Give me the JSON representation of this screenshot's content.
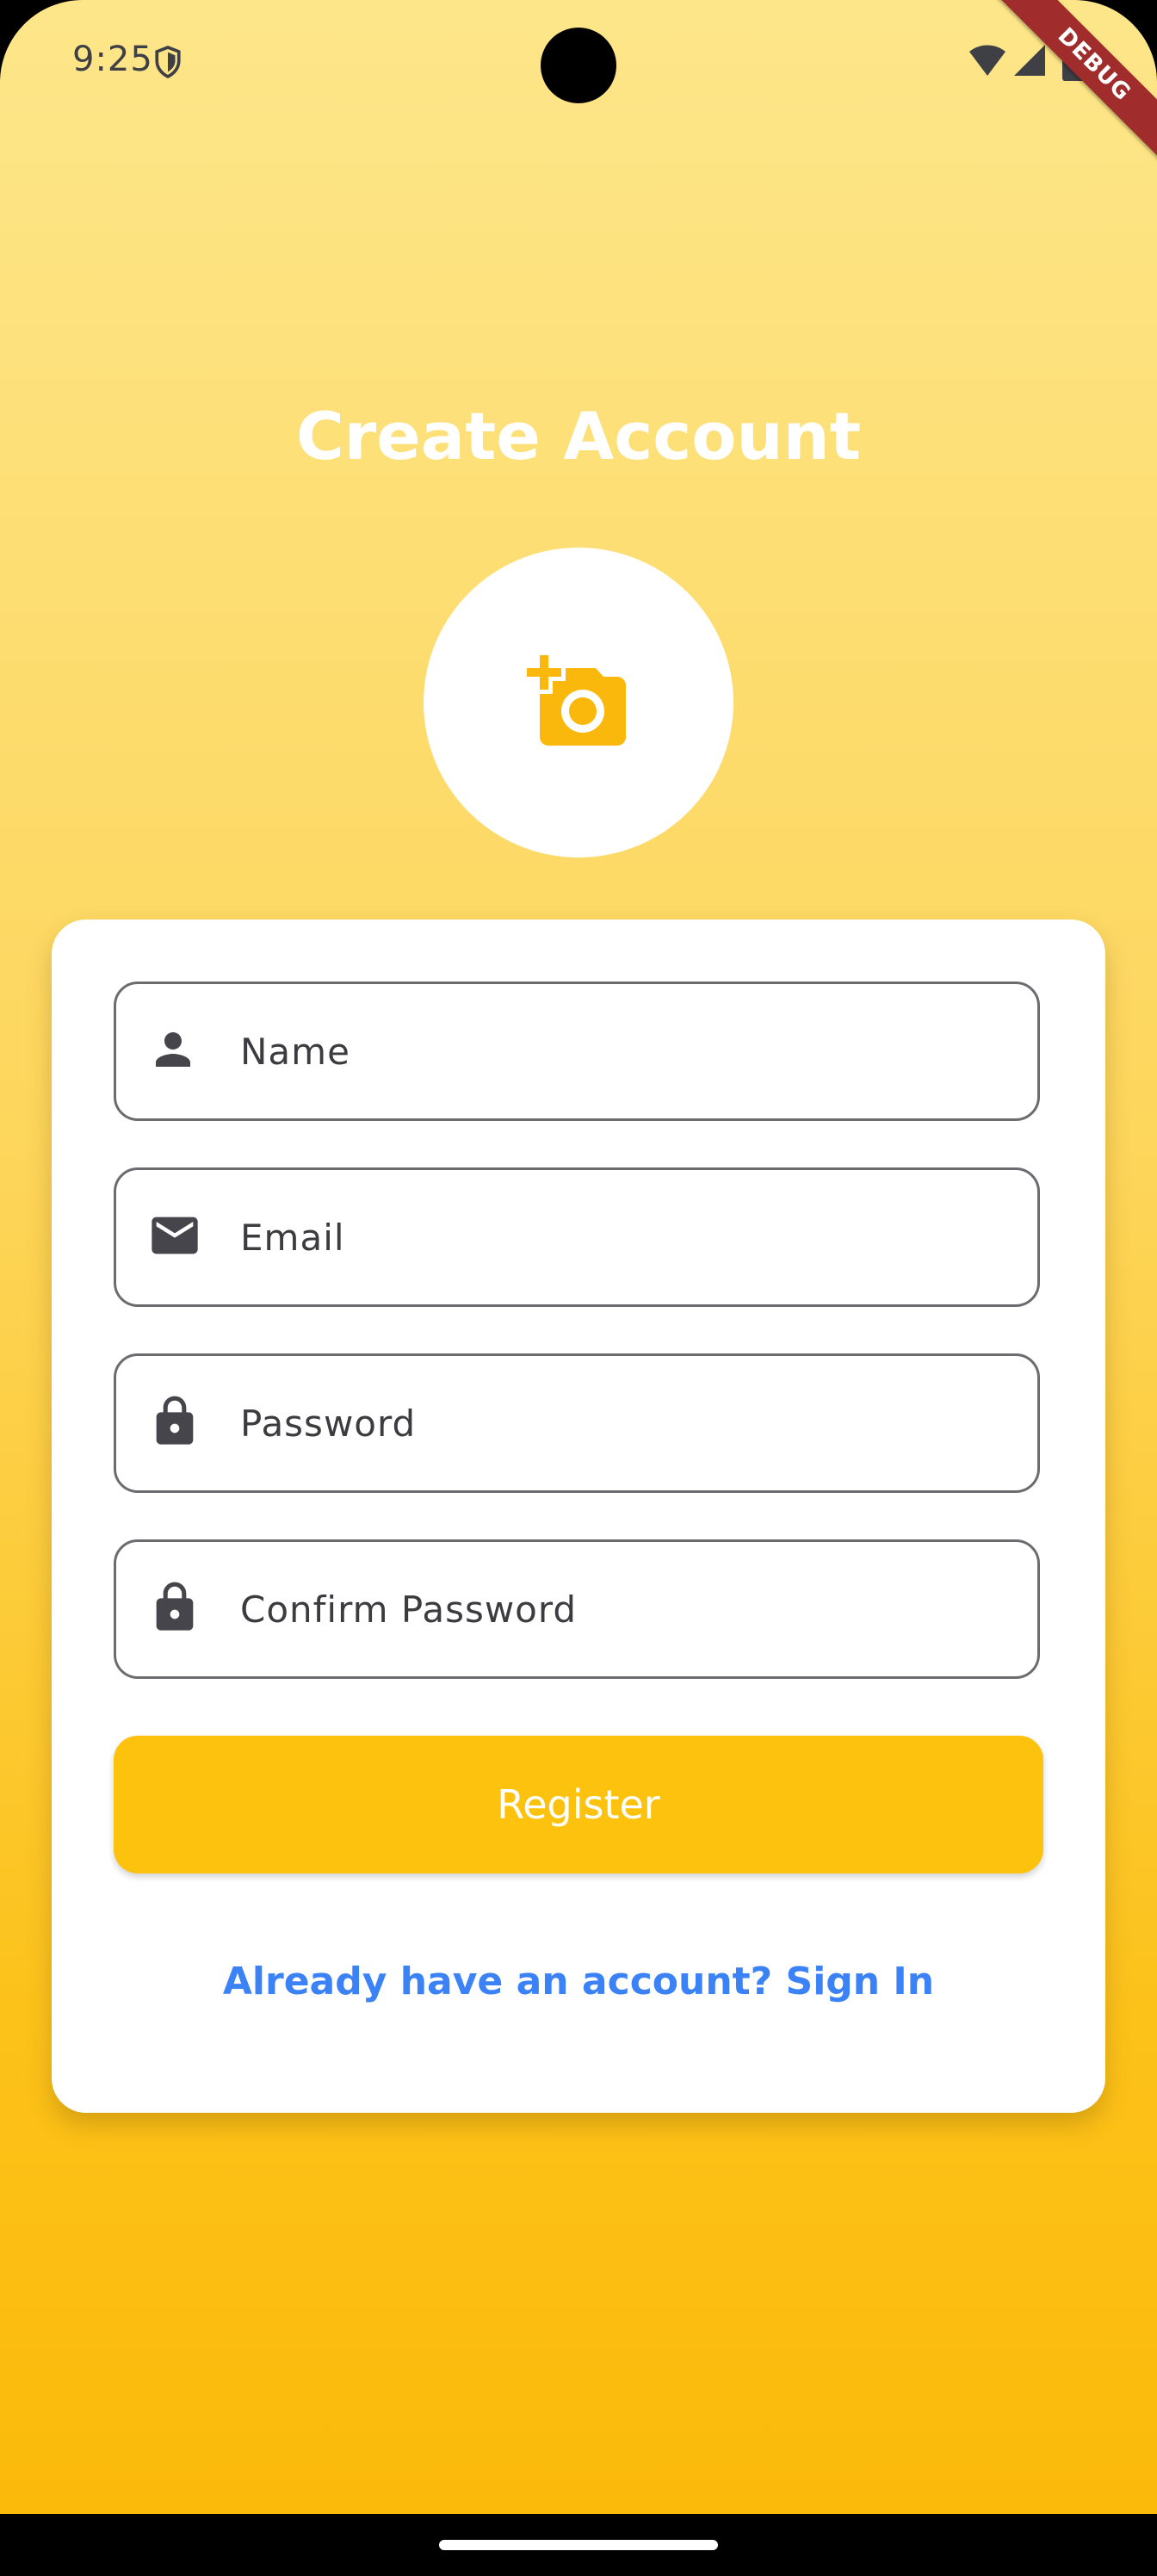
{
  "status_bar": {
    "time": "9:25",
    "icons": [
      "shield-icon",
      "wifi-icon",
      "signal-icon",
      "battery-icon"
    ]
  },
  "debug_banner": "DEBUG",
  "page": {
    "title": "Create Account"
  },
  "avatar": {
    "icon": "add-a-photo-icon",
    "icon_color": "#FBB80C"
  },
  "form": {
    "name": {
      "placeholder": "Name",
      "value": "",
      "icon": "person-icon"
    },
    "email": {
      "placeholder": "Email",
      "value": "",
      "icon": "mail-icon"
    },
    "password": {
      "placeholder": "Password",
      "value": "",
      "icon": "lock-icon"
    },
    "confirm_password": {
      "placeholder": "Confirm Password",
      "value": "",
      "icon": "lock-icon"
    },
    "register_label": "Register",
    "signin_link": "Already have an account? Sign In"
  },
  "colors": {
    "gradient_top": "#FDE68A",
    "gradient_bottom": "#FBBA0A",
    "accent": "#FCC20E",
    "link": "#3B82F6"
  }
}
